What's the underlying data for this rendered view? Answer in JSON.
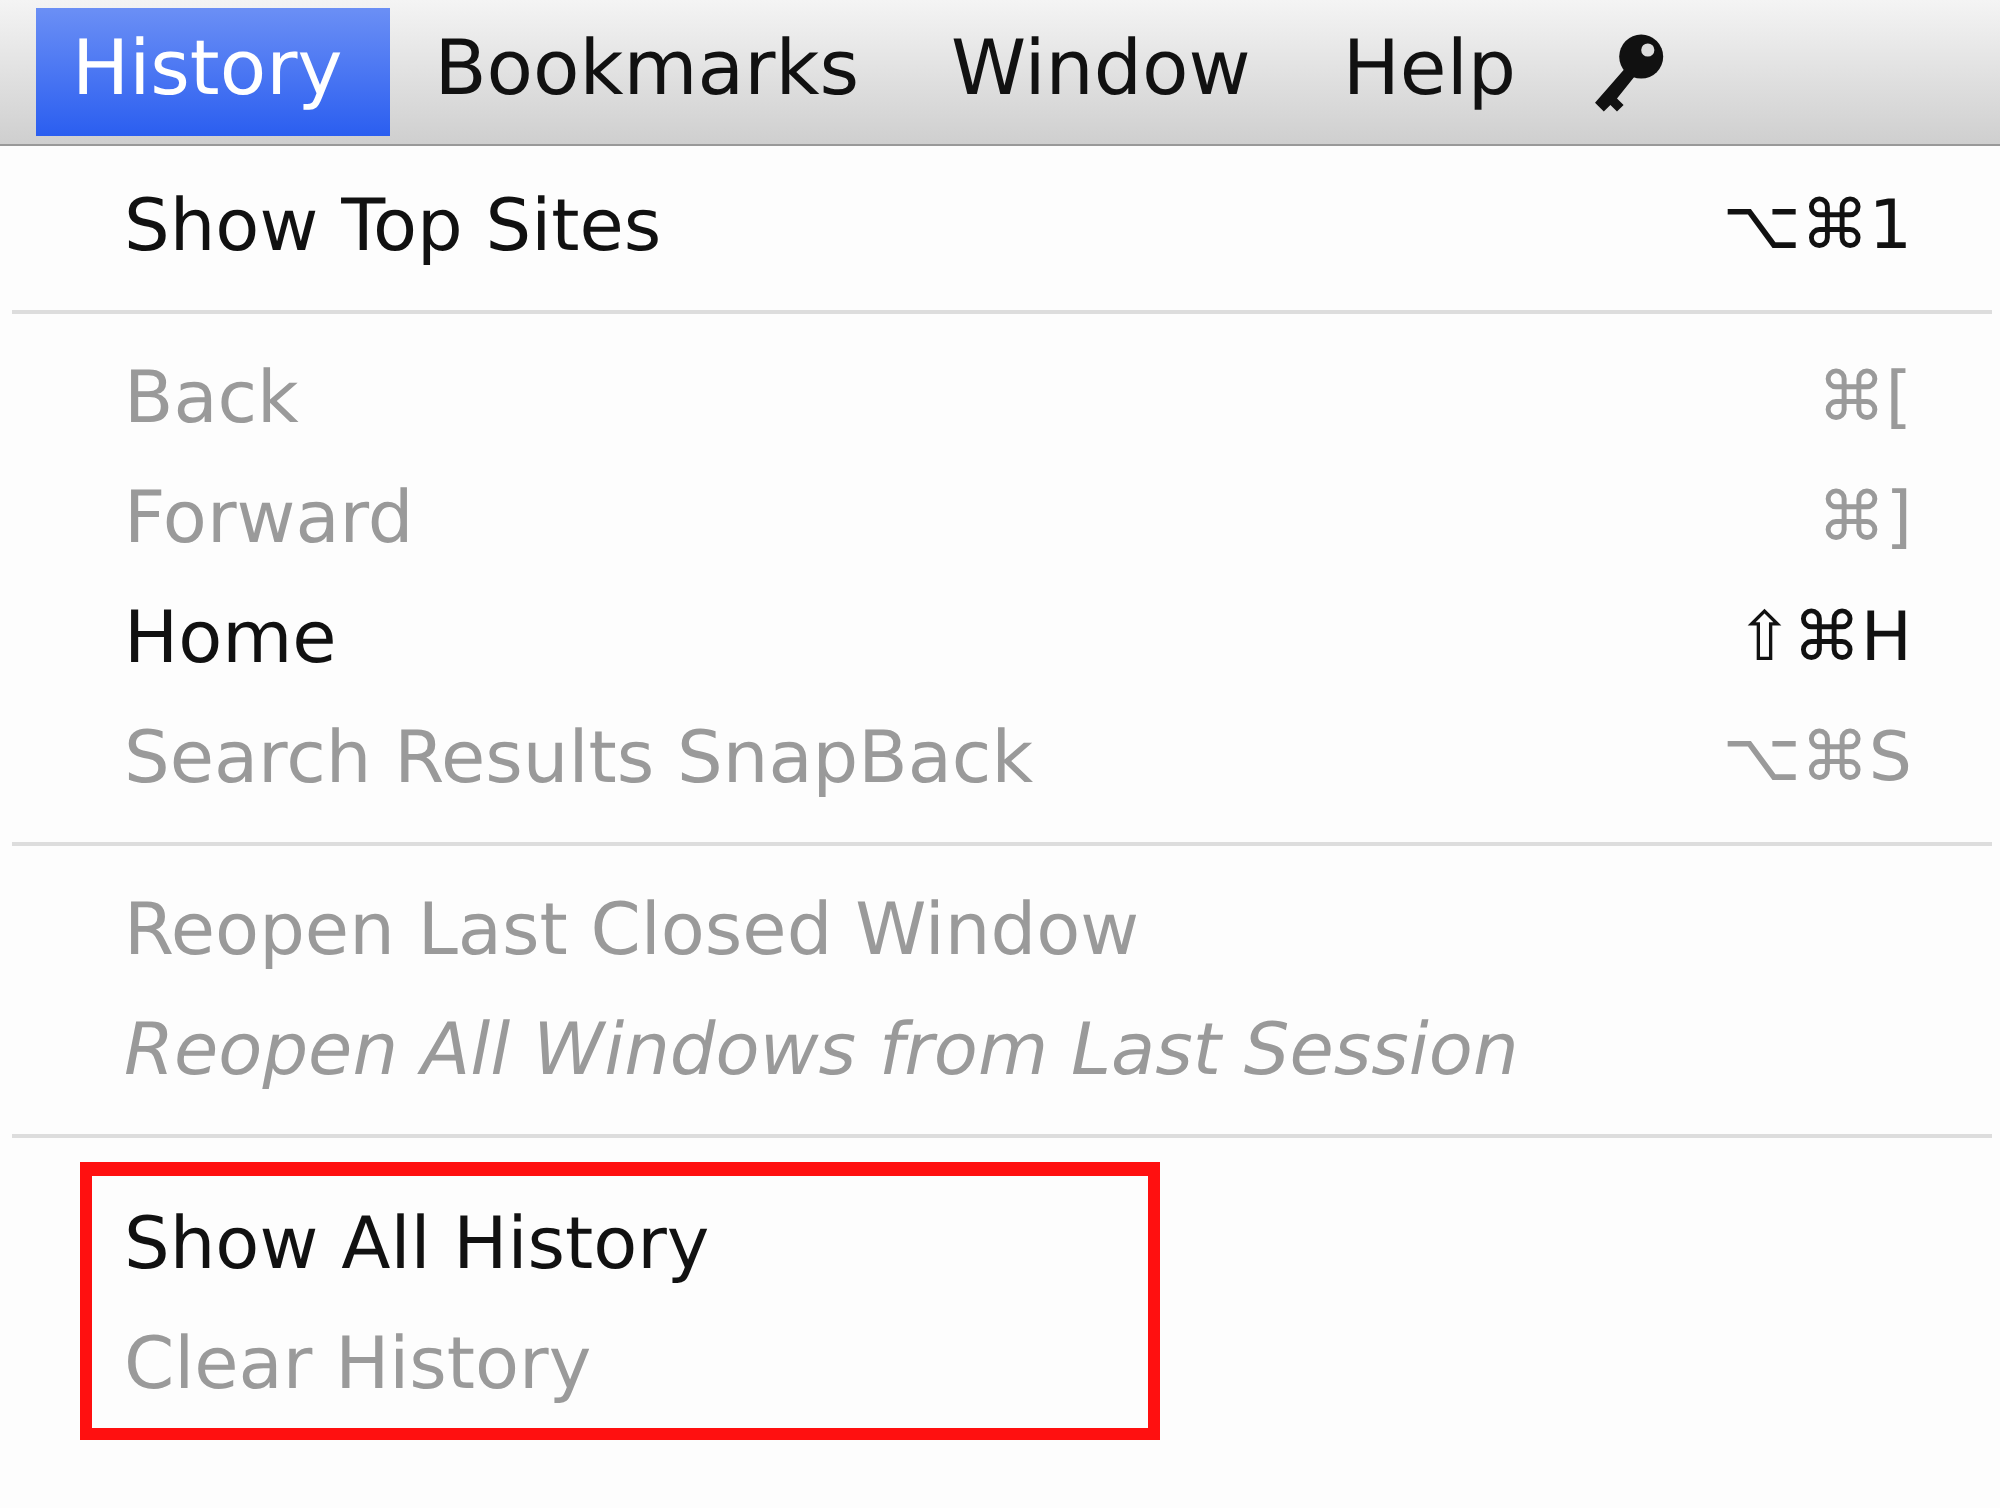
{
  "menu_bar": [
    {
      "label": "History",
      "selected": true
    },
    {
      "label": "Bookmarks",
      "selected": false
    },
    {
      "label": "Window",
      "selected": false
    },
    {
      "label": "Help",
      "selected": false
    }
  ],
  "menu": {
    "sections": [
      {
        "highlighted": false,
        "items": [
          {
            "label": "Show Top Sites",
            "shortcut": "⌥⌘1",
            "disabled": false,
            "italic": false
          }
        ]
      },
      {
        "highlighted": false,
        "items": [
          {
            "label": "Back",
            "shortcut": "⌘[",
            "disabled": true,
            "italic": false
          },
          {
            "label": "Forward",
            "shortcut": "⌘]",
            "disabled": true,
            "italic": false
          },
          {
            "label": "Home",
            "shortcut": "⇧⌘H",
            "disabled": false,
            "italic": false
          },
          {
            "label": "Search Results SnapBack",
            "shortcut": "⌥⌘S",
            "disabled": true,
            "italic": false
          }
        ]
      },
      {
        "highlighted": false,
        "items": [
          {
            "label": "Reopen Last Closed Window",
            "disabled": true,
            "italic": false
          },
          {
            "label": "Reopen All Windows from Last Session",
            "disabled": true,
            "italic": true
          }
        ]
      },
      {
        "highlighted": true,
        "items": [
          {
            "label": "Show All History",
            "disabled": false,
            "italic": false
          },
          {
            "label": "Clear History",
            "disabled": true,
            "italic": false
          }
        ]
      }
    ]
  }
}
